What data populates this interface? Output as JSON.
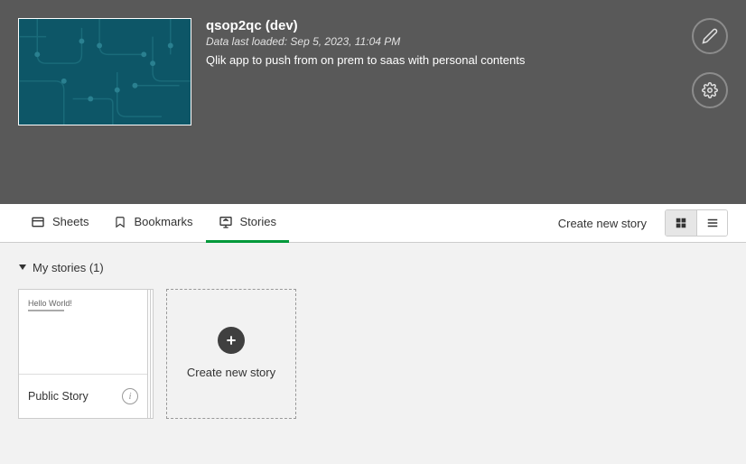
{
  "header": {
    "title": "qsop2qc (dev)",
    "loadDate": "Data last loaded: Sep 5, 2023, 11:04 PM",
    "description": "Qlik app to push from on prem to saas with personal contents"
  },
  "tabs": {
    "sheets": "Sheets",
    "bookmarks": "Bookmarks",
    "stories": "Stories"
  },
  "actions": {
    "createStoryLink": "Create new story"
  },
  "section": {
    "title": "My stories (1)"
  },
  "storyCard": {
    "previewText": "Hello World!",
    "title": "Public Story"
  },
  "createCard": {
    "label": "Create new story"
  }
}
